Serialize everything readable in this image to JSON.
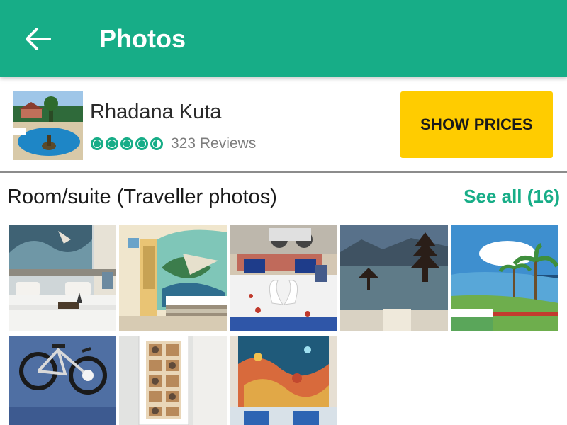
{
  "appbar": {
    "title": "Photos",
    "back_icon": "arrow-left-icon"
  },
  "hotel": {
    "name": "Rhadana Kuta",
    "rating": 4.5,
    "rating_max": 5,
    "reviews": "323 Reviews",
    "cta": "SHOW PRICES"
  },
  "section": {
    "title": "Room/suite (Traveller photos)",
    "see_all": "See all (16)"
  },
  "photos_count_shown": 8,
  "colors": {
    "brand": "#17AD87",
    "cta": "#FFCC00"
  }
}
